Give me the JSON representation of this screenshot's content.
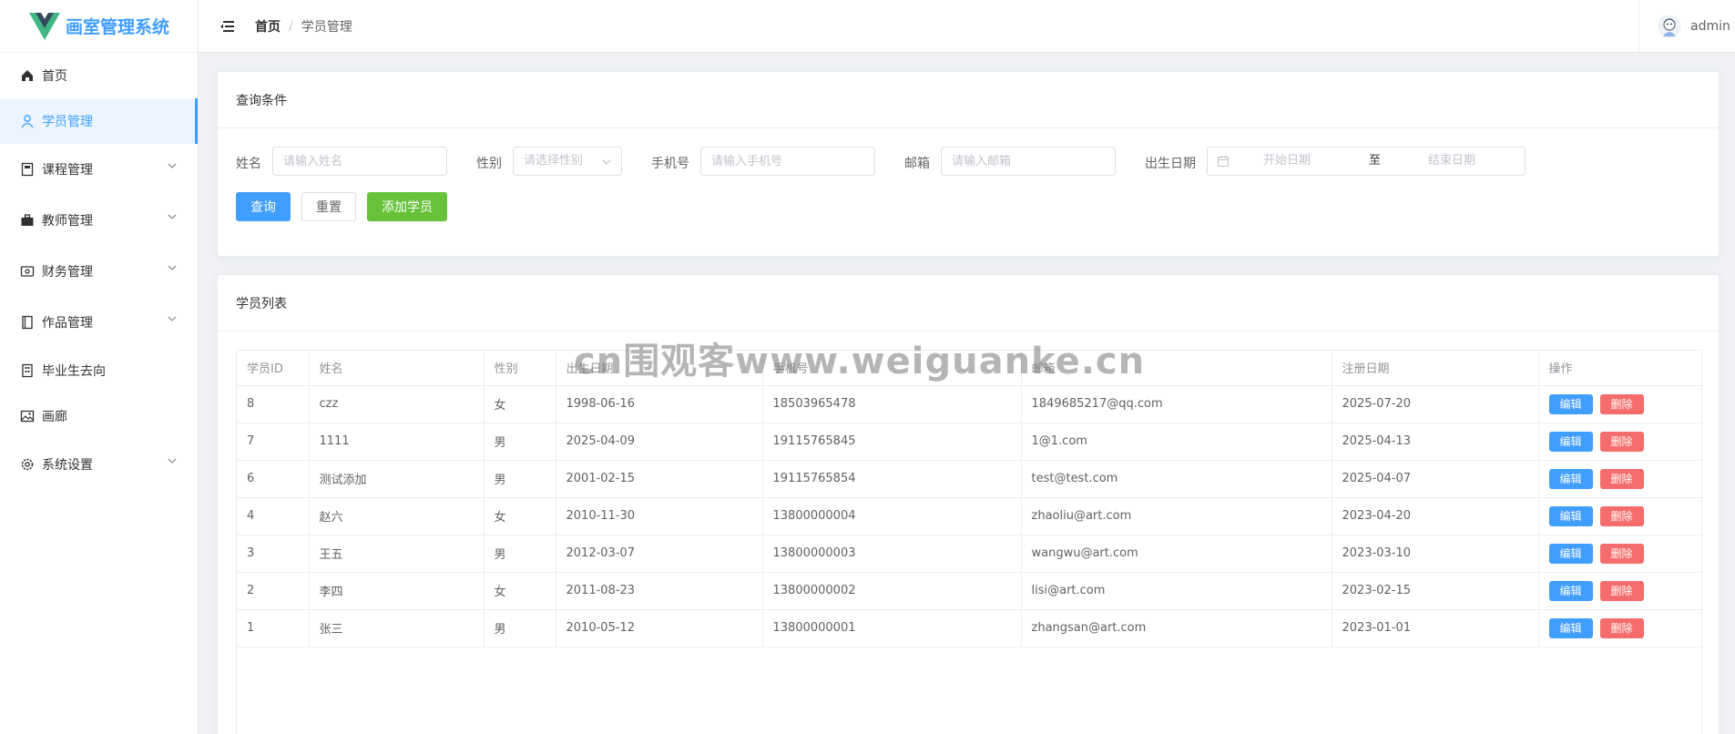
{
  "app": {
    "title": "画室管理系统",
    "brand_color": "#409eff"
  },
  "sidebar": {
    "items": [
      {
        "label": "首页",
        "icon": "home-icon",
        "has_children": false,
        "active": false
      },
      {
        "label": "学员管理",
        "icon": "user-icon",
        "has_children": false,
        "active": true
      },
      {
        "label": "课程管理",
        "icon": "notebook-icon",
        "has_children": true,
        "active": false
      },
      {
        "label": "教师管理",
        "icon": "briefcase-icon",
        "has_children": true,
        "active": false
      },
      {
        "label": "财务管理",
        "icon": "wallet-icon",
        "has_children": true,
        "active": false
      },
      {
        "label": "作品管理",
        "icon": "album-icon",
        "has_children": true,
        "active": false
      },
      {
        "label": "毕业生去向",
        "icon": "building-icon",
        "has_children": false,
        "active": false
      },
      {
        "label": "画廊",
        "icon": "picture-icon",
        "has_children": false,
        "active": false
      },
      {
        "label": "系统设置",
        "icon": "gear-icon",
        "has_children": true,
        "active": false
      }
    ]
  },
  "header": {
    "breadcrumb": {
      "home": "首页",
      "separator": "/",
      "current": "学员管理"
    },
    "username": "admin"
  },
  "query": {
    "title": "查询条件",
    "name_label": "姓名",
    "name_placeholder": "请输入姓名",
    "gender_label": "性别",
    "gender_placeholder": "请选择性别",
    "phone_label": "手机号",
    "phone_placeholder": "请输入手机号",
    "email_label": "邮箱",
    "email_placeholder": "请输入邮箱",
    "birth_label": "出生日期",
    "start_placeholder": "开始日期",
    "range_sep": "至",
    "end_placeholder": "结束日期",
    "search_btn": "查询",
    "reset_btn": "重置",
    "add_btn": "添加学员"
  },
  "list": {
    "title": "学员列表",
    "columns": [
      "学员ID",
      "姓名",
      "性别",
      "出生日期",
      "手机号",
      "邮箱",
      "注册日期",
      "操作"
    ],
    "edit_label": "编辑",
    "delete_label": "删除",
    "rows": [
      [
        "8",
        "czz",
        "女",
        "1998-06-16",
        "18503965478",
        "1849685217@qq.com",
        "2025-07-20"
      ],
      [
        "7",
        "1111",
        "男",
        "2025-04-09",
        "19115765845",
        "1@1.com",
        "2025-04-13"
      ],
      [
        "6",
        "测试添加",
        "男",
        "2001-02-15",
        "19115765854",
        "test@test.com",
        "2025-04-07"
      ],
      [
        "4",
        "赵六",
        "女",
        "2010-11-30",
        "13800000004",
        "zhaoliu@art.com",
        "2023-04-20"
      ],
      [
        "3",
        "王五",
        "男",
        "2012-03-07",
        "13800000003",
        "wangwu@art.com",
        "2023-03-10"
      ],
      [
        "2",
        "李四",
        "女",
        "2011-08-23",
        "13800000002",
        "lisi@art.com",
        "2023-02-15"
      ],
      [
        "1",
        "张三",
        "男",
        "2010-05-12",
        "13800000001",
        "zhangsan@art.com",
        "2023-01-01"
      ]
    ]
  },
  "watermark": "cn围观客www.weiguanke.cn"
}
